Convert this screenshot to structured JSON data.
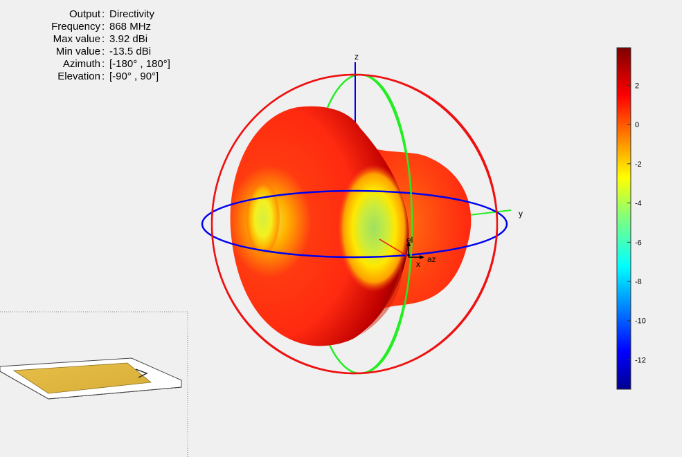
{
  "info": {
    "rows": [
      {
        "label": "Output",
        "value": "Directivity"
      },
      {
        "label": "Frequency",
        "value": "868 MHz"
      },
      {
        "label": "Max value",
        "value": "3.92 dBi"
      },
      {
        "label": "Min value",
        "value": "-13.5 dBi"
      },
      {
        "label": "Azimuth",
        "value": "[-180° , 180°]"
      },
      {
        "label": "Elevation",
        "value": "[-90° , 90°]"
      }
    ],
    "separator": ":"
  },
  "axes": {
    "z_label": "z",
    "y_label": "y",
    "x_label": "x",
    "el_label": "el",
    "az_label": "az"
  },
  "chart_data": {
    "type": "heatmap",
    "description_mode": "3D radiation pattern",
    "quantity": "Directivity",
    "unit": "dBi",
    "max": 3.92,
    "min": -13.5,
    "colorbar": {
      "ticks": [
        2,
        0,
        -2,
        -4,
        -6,
        -8,
        -10,
        -12
      ],
      "tick_labels": [
        "2",
        "0",
        "-2",
        "-4",
        "-6",
        "-8",
        "-10",
        "-12"
      ],
      "range": [
        -13.5,
        3.92
      ],
      "colormap": "jet"
    },
    "azimuth_range": [
      -180,
      180
    ],
    "elevation_range": [
      -90,
      90
    ]
  },
  "colors": {
    "azimuth_ring": "#0000ee",
    "elevation_ring": "#22ee22",
    "outer_ring": "#ee1111",
    "z_axis": "#0000ee",
    "patch": "#e0b840"
  }
}
